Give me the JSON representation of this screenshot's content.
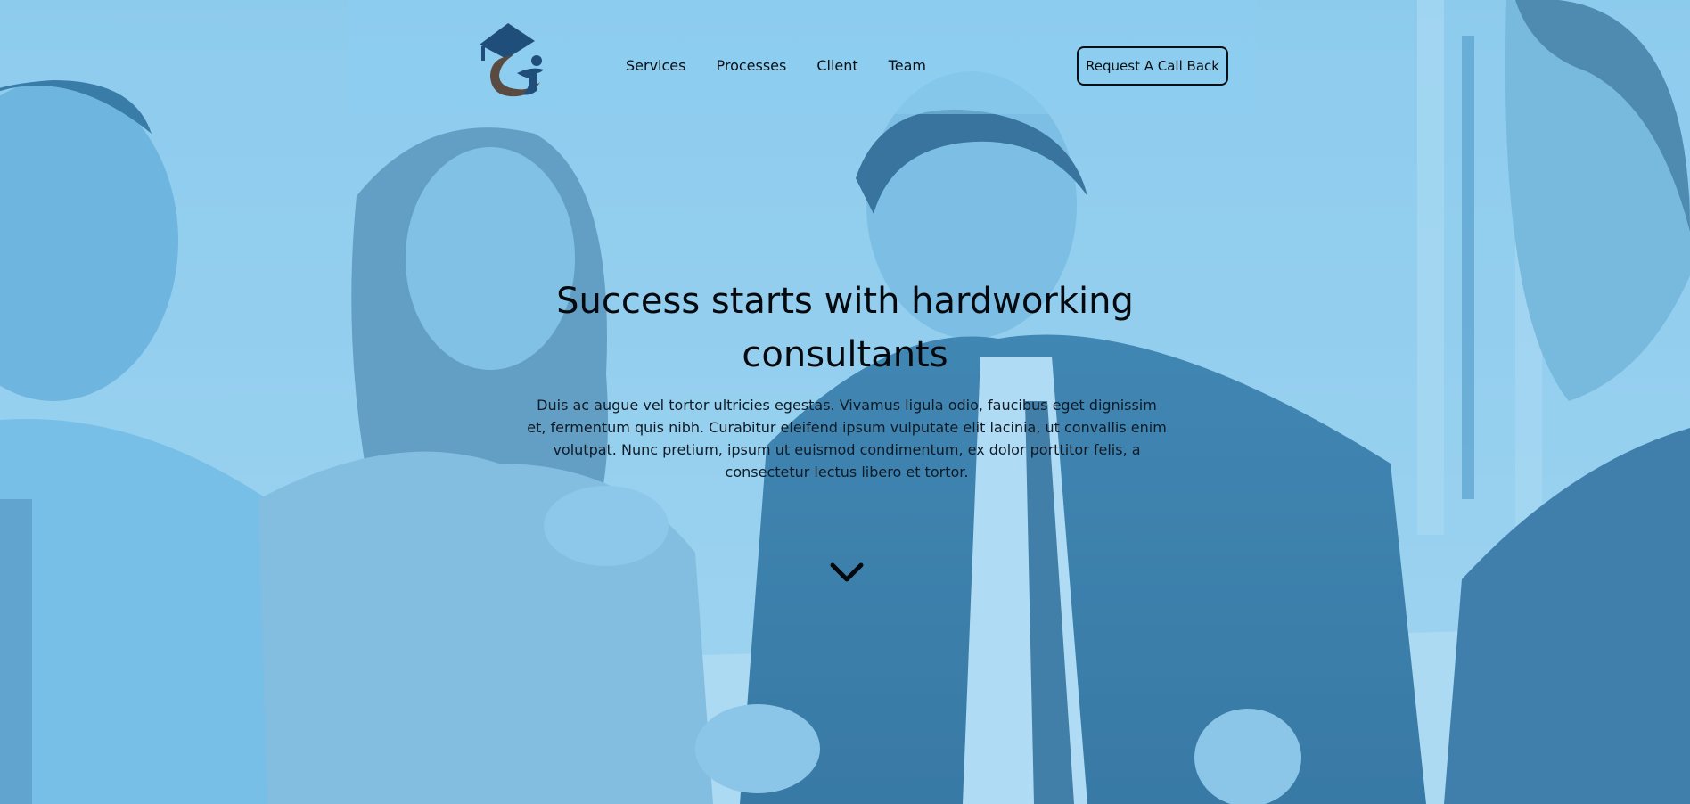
{
  "nav": {
    "links": [
      "Services",
      "Processes",
      "Client",
      "Team"
    ],
    "cta_label": "Request A Call Back"
  },
  "hero": {
    "headline_line1": "Success starts with hardworking",
    "headline_line2": "consultants",
    "description": "Duis ac augue vel tortor ultricies egestas. Vivamus ligula odio, faucibus eget dignissim et, fermentum quis nibh. Curabitur eleifend ipsum vulputate elit lacinia, ut convallis enim volutpat. Nunc pretium, ipsum ut euismod condimentum, ex dolor porttitor felis, a consectetur lectus libero et tortor."
  },
  "icons": {
    "logo": "graduation-cap-person-logo",
    "scroll": "chevron-down-icon"
  },
  "colors": {
    "overlay": "#7fc4e8",
    "text_dark": "#05090d",
    "logo_navy": "#1f4e7a",
    "logo_brown": "#5a4a42"
  }
}
